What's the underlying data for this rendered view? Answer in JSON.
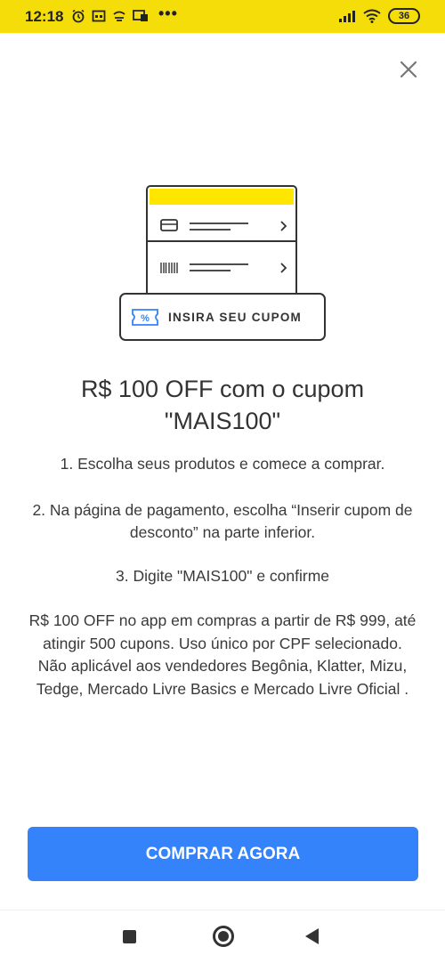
{
  "status_bar": {
    "time": "12:18",
    "battery": "36",
    "more": "•••"
  },
  "illustration": {
    "coupon_label": "INSIRA SEU CUPOM"
  },
  "modal": {
    "title": "R$ 100 OFF com o cupom \"MAIS100\"",
    "steps": [
      "1. Escolha seus produtos e comece a comprar.",
      "2. Na página de pagamento, escolha “Inserir cupom de desconto” na parte inferior.",
      "3. Digite \"MAIS100\" e confirme"
    ],
    "terms": "R$ 100 OFF no app em compras a partir de R$ 999, até atingir 500 cupons. Uso único por CPF selecionado. Não aplicável aos vendedores Begônia, Klatter, Mizu, Tedge, Mercado Livre Basics e Mercado Livre Oficial .",
    "cta_label": "COMPRAR AGORA"
  },
  "colors": {
    "status_bar": "#f5dd0a",
    "accent": "#3483fa",
    "text": "#333333"
  }
}
